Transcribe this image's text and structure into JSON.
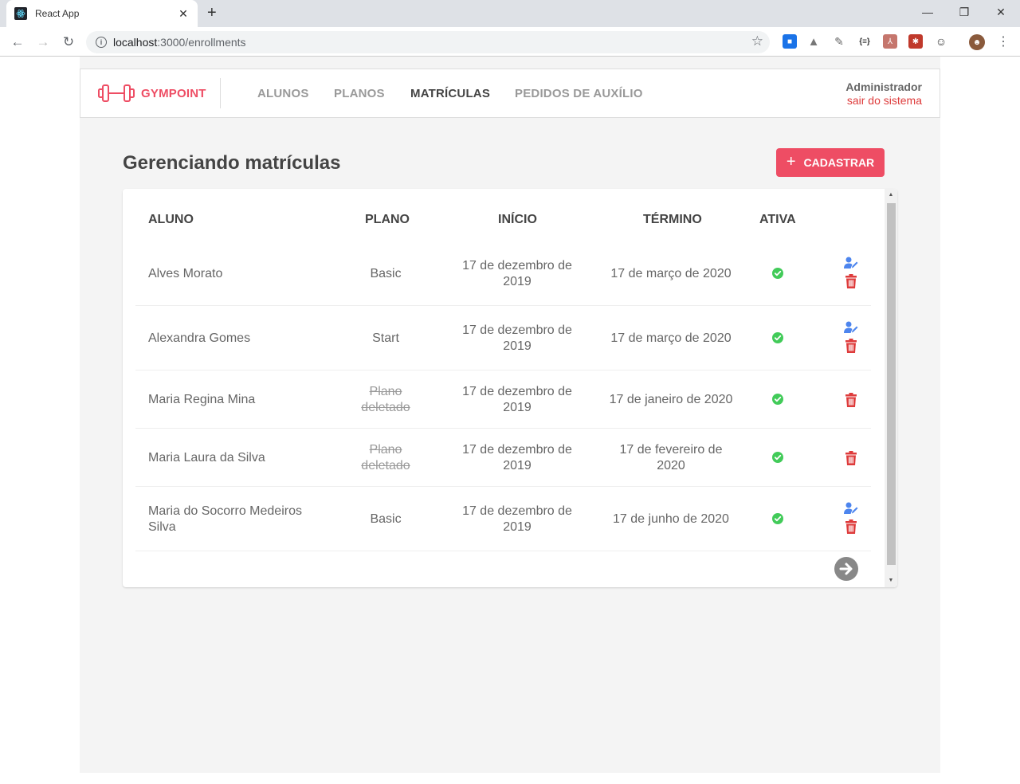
{
  "browser": {
    "tab_title": "React App",
    "url_host": "localhost",
    "url_path": ":3000/enrollments"
  },
  "app": {
    "brand": "GYMPOINT",
    "nav": [
      {
        "label": "ALUNOS",
        "active": false
      },
      {
        "label": "PLANOS",
        "active": false
      },
      {
        "label": "MATRÍCULAS",
        "active": true
      },
      {
        "label": "PEDIDOS DE AUXÍLIO",
        "active": false
      }
    ],
    "user": {
      "name": "Administrador",
      "logout": "sair do sistema"
    },
    "colors": {
      "brand": "#ee4d64",
      "edit": "#4d85ee",
      "delete": "#de3b3b",
      "active": "#42cb59"
    }
  },
  "page": {
    "title": "Gerenciando matrículas",
    "add_button": "CADASTRAR"
  },
  "table": {
    "headers": {
      "aluno": "ALUNO",
      "plano": "PLANO",
      "inicio": "INÍCIO",
      "termino": "TÉRMINO",
      "ativa": "ATIVA"
    },
    "rows": [
      {
        "aluno": "Alves Morato",
        "plano": "Basic",
        "plano_deleted": false,
        "inicio": "17 de dezembro de 2019",
        "termino": "17 de março de 2020",
        "ativa": true,
        "editable": true
      },
      {
        "aluno": "Alexandra Gomes",
        "plano": "Start",
        "plano_deleted": false,
        "inicio": "17 de dezembro de 2019",
        "termino": "17 de março de 2020",
        "ativa": true,
        "editable": true
      },
      {
        "aluno": "Maria Regina Mina",
        "plano": "Plano deletado",
        "plano_deleted": true,
        "inicio": "17 de dezembro de 2019",
        "termino": "17 de janeiro de 2020",
        "ativa": true,
        "editable": false
      },
      {
        "aluno": "Maria Laura da Silva",
        "plano": "Plano deletado",
        "plano_deleted": true,
        "inicio": "17 de dezembro de 2019",
        "termino": "17 de fevereiro de 2020",
        "ativa": true,
        "editable": false
      },
      {
        "aluno": "Maria do Socorro Medeiros Silva",
        "plano": "Basic",
        "plano_deleted": false,
        "inicio": "17 de dezembro de 2019",
        "termino": "17 de junho de 2020",
        "ativa": true,
        "editable": true
      }
    ]
  }
}
